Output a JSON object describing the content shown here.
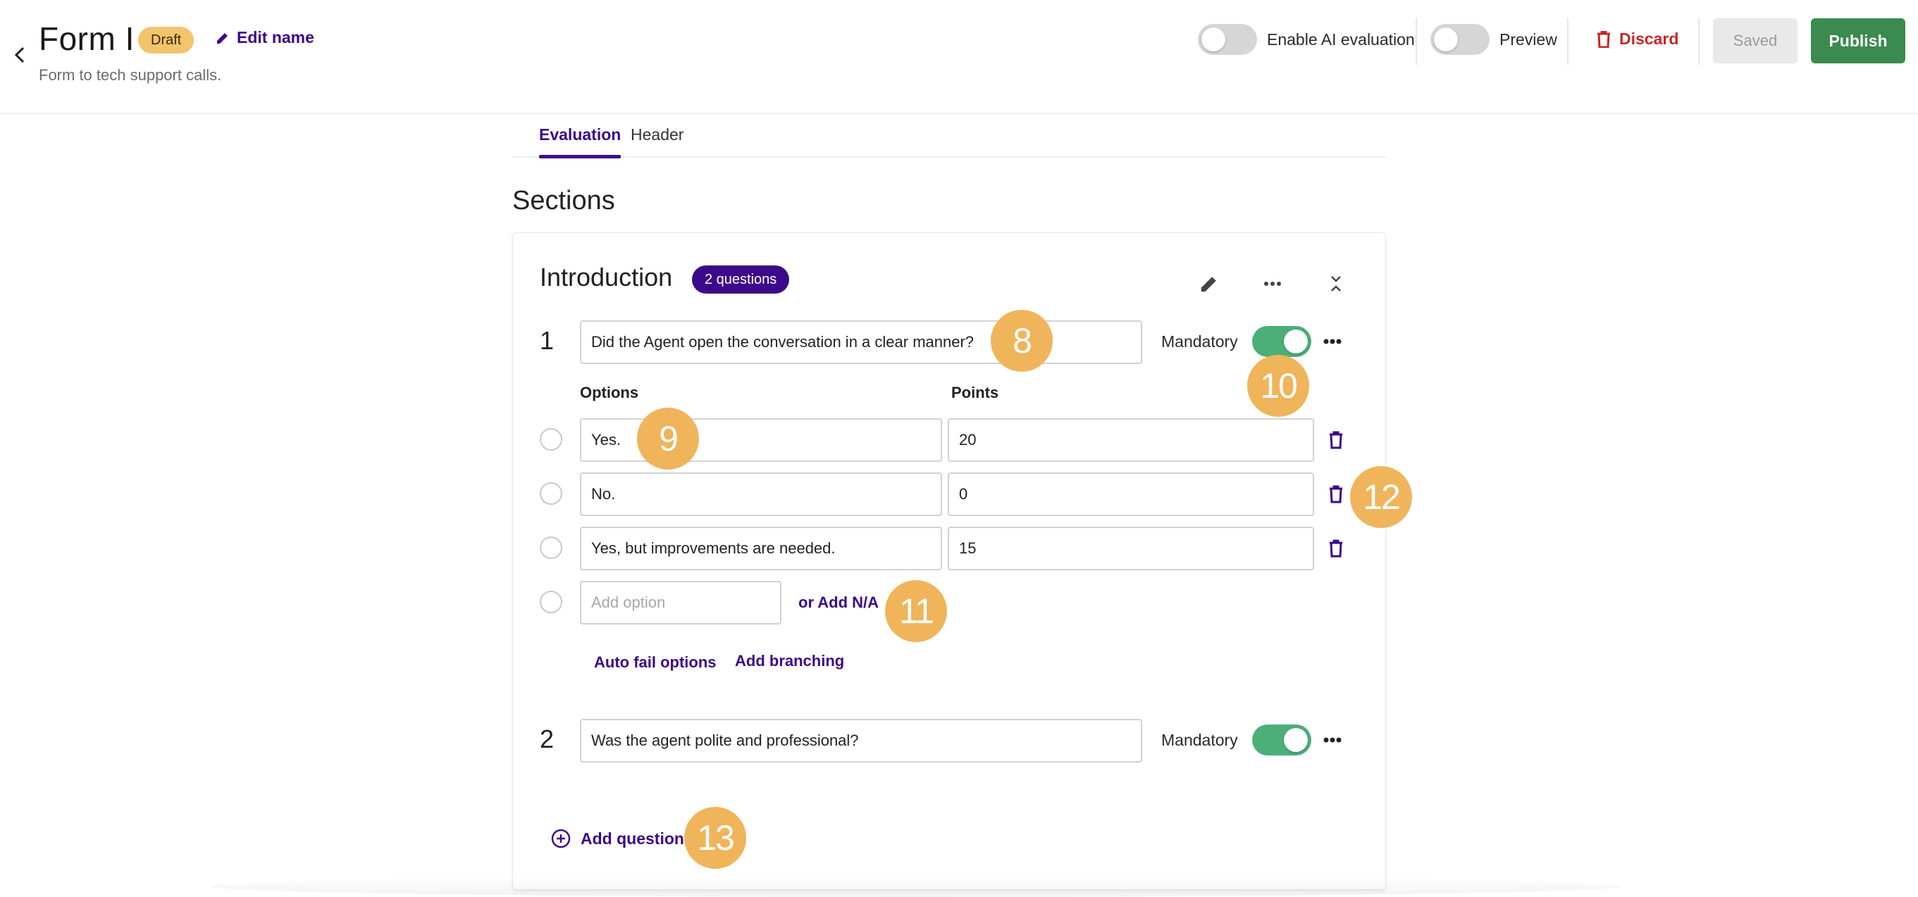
{
  "header": {
    "title": "Form I",
    "status_badge": "Draft",
    "edit_name_label": "Edit name",
    "subtitle": "Form to tech support calls.",
    "ai_toggle": {
      "label": "Enable AI evaluation",
      "on": false
    },
    "preview_toggle": {
      "label": "Preview",
      "on": false
    },
    "discard_label": "Discard",
    "saved_label": "Saved",
    "publish_label": "Publish"
  },
  "tabs": [
    {
      "label": "Evaluation",
      "active": true
    },
    {
      "label": "Header",
      "active": false
    }
  ],
  "sections_title": "Sections",
  "section": {
    "title": "Introduction",
    "question_count_badge": "2 questions",
    "questions": [
      {
        "number": "1",
        "text": "Did the Agent open the conversation in a clear manner?",
        "mandatory_label": "Mandatory",
        "mandatory": true,
        "options_header": "Options",
        "points_header": "Points",
        "options": [
          {
            "label": "Yes.",
            "points": "20"
          },
          {
            "label": "No.",
            "points": "0"
          },
          {
            "label": "Yes, but improvements are needed.",
            "points": "15"
          }
        ],
        "add_option_placeholder": "Add option",
        "add_na_label": "or Add N/A",
        "auto_fail_label": "Auto fail options",
        "add_branching_label": "Add branching"
      },
      {
        "number": "2",
        "text": "Was the agent polite and professional?",
        "mandatory_label": "Mandatory",
        "mandatory": true
      }
    ],
    "add_question_label": "Add question"
  },
  "callouts": [
    "8",
    "9",
    "10",
    "11",
    "12",
    "13"
  ],
  "colors": {
    "accent": "#3b0a8a",
    "publish": "#3b8a4f",
    "discard": "#c62828",
    "draft_badge": "#f2c46d",
    "toggle_on": "#4caf78",
    "callout": "#f0b45a"
  },
  "icons": {
    "back": "chevron-left-icon",
    "edit": "pencil-icon",
    "discard": "trash-icon",
    "more": "more-horizontal-icon",
    "collapse": "collapse-icon",
    "add": "plus-circle-icon"
  }
}
